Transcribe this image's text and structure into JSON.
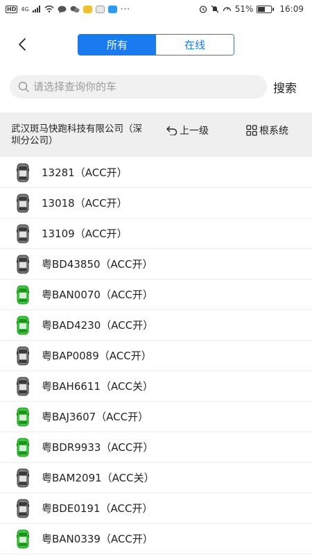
{
  "colors": {
    "accent": "#1a7bf0",
    "car_online": "#3cc83c",
    "car_offline": "#7a7a7a",
    "org_bar_bg": "#efefef",
    "search_bg": "#f1f1f1"
  },
  "status_bar": {
    "signal_label": "HD",
    "network_label": "4G",
    "battery": "51%",
    "battery_level": 0.51,
    "time": "16:09"
  },
  "header": {
    "back_icon": "chevron-left-icon",
    "tabs": [
      {
        "label": "所有",
        "active": true
      },
      {
        "label": "在线",
        "active": false
      }
    ]
  },
  "search": {
    "placeholder": "请选择查询你的车",
    "button_label": "搜索",
    "icon": "search-icon"
  },
  "org": {
    "name": "武汉斑马快跑科技有限公司（深圳分公司）",
    "up_label": "上一级",
    "up_icon": "undo-arrow-icon",
    "root_label": "根系统",
    "root_icon": "grid-icon"
  },
  "vehicles": [
    {
      "label": "13281（ACC开）",
      "online": false
    },
    {
      "label": "13018（ACC开）",
      "online": false
    },
    {
      "label": "13109（ACC开）",
      "online": false
    },
    {
      "label": "粤BD43850（ACC开）",
      "online": false
    },
    {
      "label": "粤BAN0070（ACC开）",
      "online": true
    },
    {
      "label": "粤BAD4230（ACC开）",
      "online": true
    },
    {
      "label": "粤BAP0089（ACC开）",
      "online": false
    },
    {
      "label": "粤BAH6611（ACC关）",
      "online": false
    },
    {
      "label": "粤BAJ3607（ACC开）",
      "online": true
    },
    {
      "label": "粤BDR9933（ACC开）",
      "online": true
    },
    {
      "label": "粤BAM2091（ACC关）",
      "online": false
    },
    {
      "label": "粤BDE0191（ACC开）",
      "online": false
    },
    {
      "label": "粤BAN0339（ACC开）",
      "online": true
    }
  ]
}
